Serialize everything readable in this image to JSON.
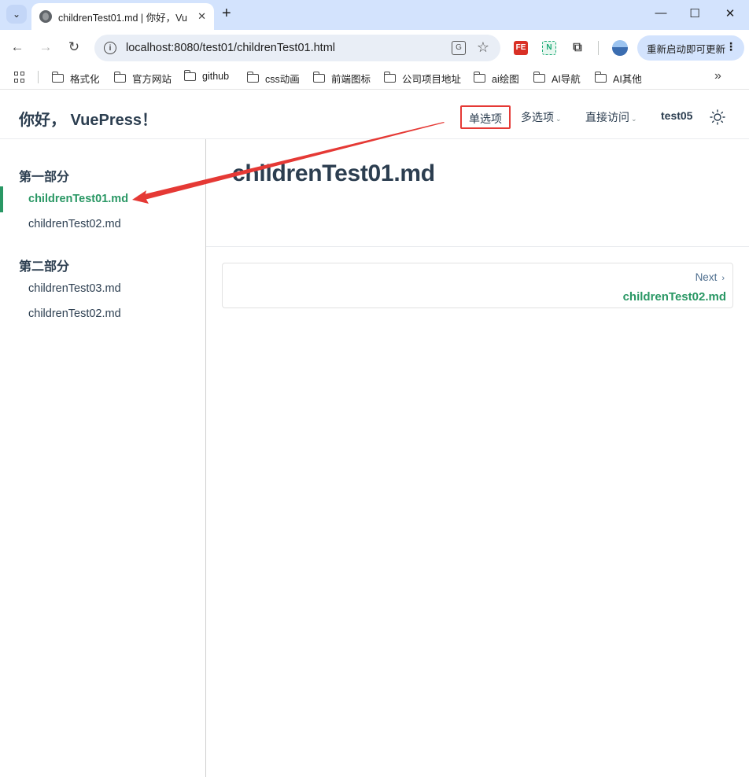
{
  "browser": {
    "tab_title": "childrenTest01.md | 你好，Vu",
    "tab_close": "✕",
    "new_tab": "+",
    "url": "localhost:8080/test01/childrenTest01.html",
    "update_button": "重新启动即可更新",
    "extensions": [
      "FE",
      "N"
    ],
    "bookmarks": [
      "格式化",
      "官方网站",
      "github",
      "css动画",
      "前端图标",
      "公司项目地址",
      "ai绘图",
      "AI导航",
      "AI其他"
    ],
    "bookmarks_overflow": "»"
  },
  "navbar": {
    "site_name": "你好， VuePress！",
    "items": [
      "单选项",
      "多选项",
      "直接访问",
      "test05"
    ],
    "dropdown_caret": "⌄"
  },
  "sidebar": {
    "groups": [
      {
        "title": "第一部分",
        "links": [
          "childrenTest01.md",
          "childrenTest02.md"
        ]
      },
      {
        "title": "第二部分",
        "links": [
          "childrenTest03.md",
          "childrenTest02.md"
        ]
      }
    ],
    "active_link": "childrenTest01.md"
  },
  "content": {
    "title": "childrenTest01.md",
    "next_label": "Next",
    "next_chevron": "›",
    "next_link": "childrenTest02.md"
  },
  "colors": {
    "accent": "#299764",
    "annotation": "#e53935",
    "chrome_tabstrip": "#d3e3fd"
  }
}
